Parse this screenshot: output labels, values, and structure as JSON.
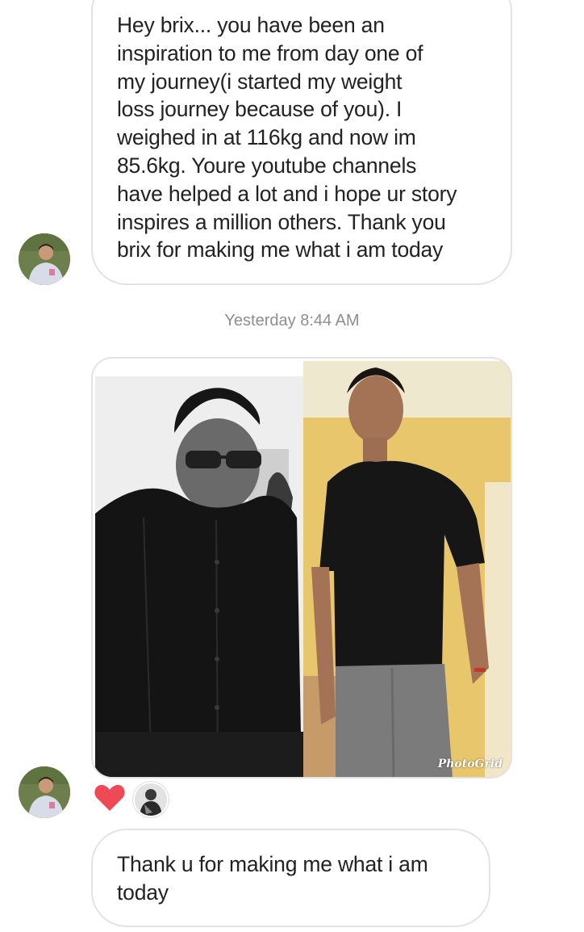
{
  "messages": [
    {
      "lines": [
        "Hey brix... you have been an",
        "inspiration to me from day one of",
        "my journey(i started my weight",
        "loss journey because of you). I",
        "weighed in at 116kg and now im",
        "85.6kg. Youre youtube channels",
        "have helped a lot and i hope ur story",
        "inspires a million others. Thank you",
        "brix for making me what i am today"
      ]
    },
    {
      "lines": [
        "Thank u for making me what i am",
        "today"
      ]
    }
  ],
  "timestamp": "Yesterday 8:44 AM",
  "photo": {
    "watermark": "PhotoGrid"
  },
  "reactions": {
    "heart_color": "#ed4956"
  },
  "icons": {
    "avatar": "user-avatar",
    "heart": "heart-icon"
  }
}
